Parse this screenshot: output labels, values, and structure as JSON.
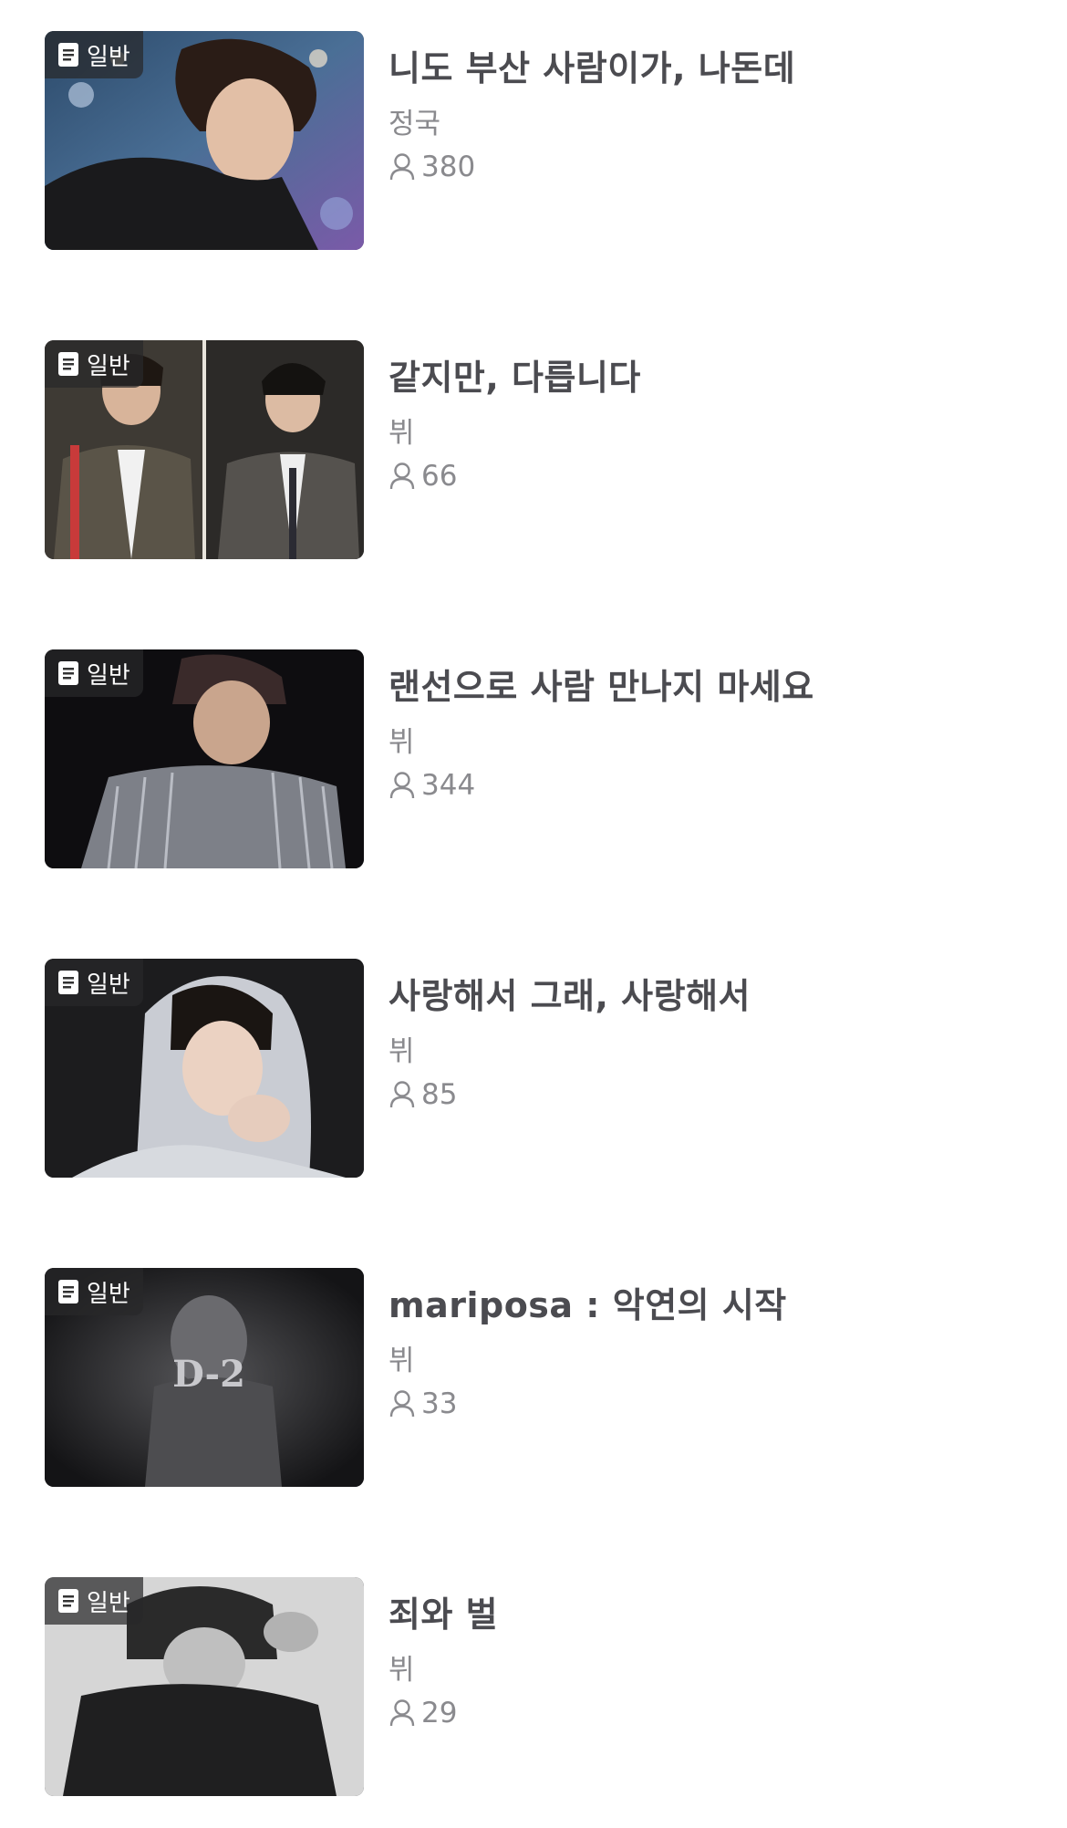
{
  "posts": [
    {
      "badge": "일반",
      "title": "니도 부산 사람이가, 나돈데",
      "author": "정국",
      "views": "380"
    },
    {
      "badge": "일반",
      "title": "같지만, 다릅니다",
      "author": "뷔",
      "views": "66"
    },
    {
      "badge": "일반",
      "title": "랜선으로 사람 만나지 마세요",
      "author": "뷔",
      "views": "344"
    },
    {
      "badge": "일반",
      "title": "사랑해서 그래, 사랑해서",
      "author": "뷔",
      "views": "85"
    },
    {
      "badge": "일반",
      "title": "mariposa : 악연의 시작",
      "author": "뷔",
      "views": "33"
    },
    {
      "badge": "일반",
      "title": "죄와 벌",
      "author": "뷔",
      "views": "29"
    }
  ],
  "thumbnail_texts": {
    "post_5": "D-2"
  },
  "icons": {
    "badge": "document-icon",
    "views": "user-icon"
  },
  "colors": {
    "title": "#4b4b50",
    "meta": "#8a8a8e",
    "badge_bg": "#28282a"
  }
}
